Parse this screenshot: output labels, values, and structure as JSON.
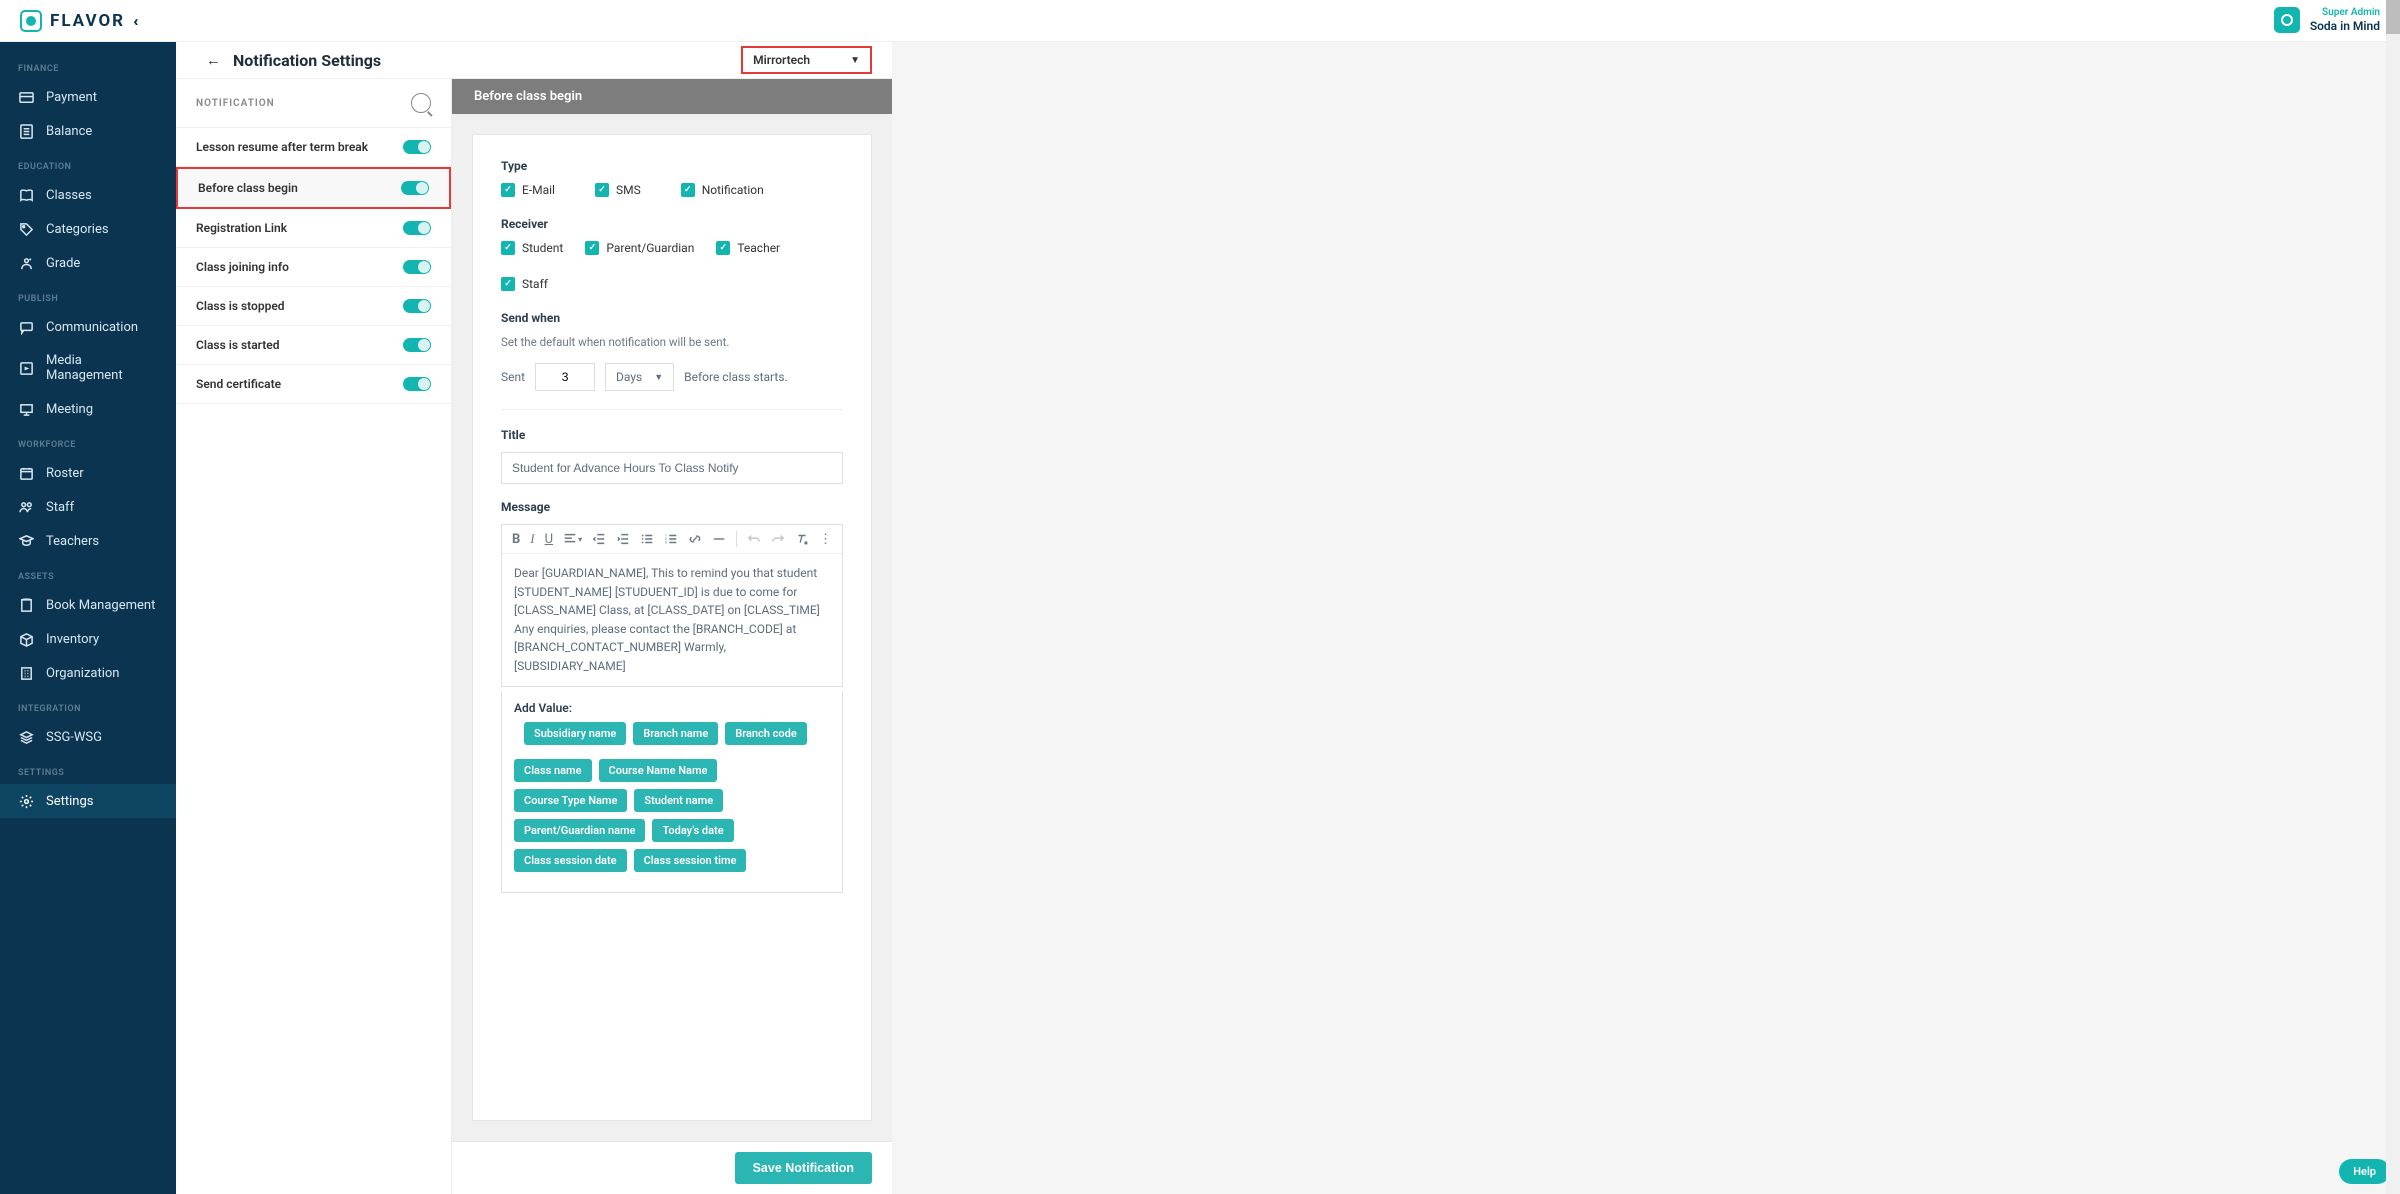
{
  "brand": "FLAVOR",
  "user": {
    "role": "Super Admin",
    "org": "Soda in Mind"
  },
  "org_select": "Mirrortech",
  "page_title": "Notification Settings",
  "sidebar": {
    "sections": [
      {
        "label": "FINANCE",
        "items": [
          {
            "key": "payment",
            "label": "Payment",
            "icon": "card"
          },
          {
            "key": "balance",
            "label": "Balance",
            "icon": "calc"
          }
        ]
      },
      {
        "label": "EDUCATION",
        "items": [
          {
            "key": "classes",
            "label": "Classes",
            "icon": "book-open"
          },
          {
            "key": "categories",
            "label": "Categories",
            "icon": "tag"
          },
          {
            "key": "grade",
            "label": "Grade",
            "icon": "star-person"
          }
        ]
      },
      {
        "label": "PUBLISH",
        "items": [
          {
            "key": "communication",
            "label": "Communication",
            "icon": "chat"
          },
          {
            "key": "media",
            "label": "Media Management",
            "icon": "media"
          },
          {
            "key": "meeting",
            "label": "Meeting",
            "icon": "present"
          }
        ]
      },
      {
        "label": "WORKFORCE",
        "items": [
          {
            "key": "roster",
            "label": "Roster",
            "icon": "calendar"
          },
          {
            "key": "staff",
            "label": "Staff",
            "icon": "people"
          },
          {
            "key": "teachers",
            "label": "Teachers",
            "icon": "grad"
          }
        ]
      },
      {
        "label": "ASSETS",
        "items": [
          {
            "key": "bookmgmt",
            "label": "Book Management",
            "icon": "book"
          },
          {
            "key": "inventory",
            "label": "Inventory",
            "icon": "box"
          },
          {
            "key": "organization",
            "label": "Organization",
            "icon": "building"
          }
        ]
      },
      {
        "label": "INTEGRATION",
        "items": [
          {
            "key": "ssgwsg",
            "label": "SSG-WSG",
            "icon": "layers"
          }
        ]
      },
      {
        "label": "SETTINGS",
        "items": [
          {
            "key": "settings",
            "label": "Settings",
            "icon": "gear",
            "active": true
          }
        ]
      }
    ]
  },
  "notif_panel": {
    "header": "NOTIFICATION",
    "items": [
      {
        "label": "Lesson resume after term break",
        "on": true
      },
      {
        "label": "Before class begin",
        "on": true,
        "highlight": true
      },
      {
        "label": "Registration Link",
        "on": true
      },
      {
        "label": "Class joining info",
        "on": true
      },
      {
        "label": "Class is stopped",
        "on": true
      },
      {
        "label": "Class is started",
        "on": true
      },
      {
        "label": "Send certificate",
        "on": true
      }
    ]
  },
  "detail": {
    "header": "Before class begin",
    "type_label": "Type",
    "types": [
      {
        "label": "E-Mail",
        "checked": true
      },
      {
        "label": "SMS",
        "checked": true
      },
      {
        "label": "Notification",
        "checked": true
      }
    ],
    "receiver_label": "Receiver",
    "receivers": [
      {
        "label": "Student",
        "checked": true
      },
      {
        "label": "Parent/Guardian",
        "checked": true
      },
      {
        "label": "Teacher",
        "checked": true
      },
      {
        "label": "Staff",
        "checked": true
      }
    ],
    "send_when_label": "Send when",
    "send_when_desc": "Set the default when notification will be sent.",
    "sent_label": "Sent",
    "sent_value": "3",
    "sent_unit": "Days",
    "sent_after_text": "Before class starts.",
    "title_label": "Title",
    "title_value": "Student for Advance Hours To Class Notify",
    "message_label": "Message",
    "message_body": "Dear [GUARDIAN_NAME], This to remind you that student [STUDENT_NAME] [STUDUENT_ID] is due to come for [CLASS_NAME] Class, at [CLASS_DATE] on [CLASS_TIME] Any enquiries, please contact the [BRANCH_CODE] at [BRANCH_CONTACT_NUMBER] Warmly, [SUBSIDIARY_NAME]",
    "add_value_label": "Add Value:",
    "chips": [
      "Subsidiary name",
      "Branch name",
      "Branch code",
      "Class name",
      "Course Name Name",
      "Course Type Name",
      "Student name",
      "Parent/Guardian name",
      "Today's date",
      "Class session date",
      "Class session time"
    ],
    "save_label": "Save Notification"
  },
  "help_label": "Help"
}
